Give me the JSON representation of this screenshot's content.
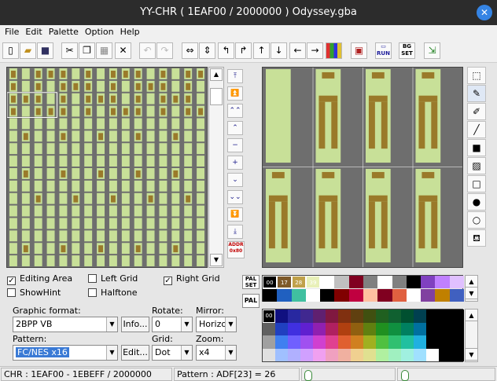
{
  "window": {
    "title": "YY-CHR ( 1EAF00 / 2000000 ) Odyssey.gba"
  },
  "menu": [
    "File",
    "Edit",
    "Palette",
    "Option",
    "Help"
  ],
  "toolbar": {
    "icons": [
      "new-file-icon",
      "open-folder-icon",
      "save-icon",
      "cut-icon",
      "copy-icon",
      "paste-icon",
      "delete-icon",
      "undo-icon",
      "redo-icon",
      "flip-horizontal-icon",
      "flip-vertical-icon",
      "rotate-left-icon",
      "rotate-right-icon",
      "shift-up-icon",
      "shift-down-icon",
      "shift-left-icon",
      "shift-right-icon",
      "palette-replace-icon",
      "script-icon",
      "run-icon",
      "set-icon",
      "exit-icon"
    ],
    "run_label": "RUN",
    "set_label": "SET"
  },
  "nav": {
    "addr_label": "ADDR",
    "addr_value": "0x80"
  },
  "tools": [
    "select-tool-icon",
    "pen-tool-icon",
    "line-tool-icon",
    "straight-line-icon",
    "filled-rect-icon",
    "pattern-fill-icon",
    "rect-tool-icon",
    "filled-circle-icon",
    "circle-tool-icon",
    "fill-bucket-icon"
  ],
  "options": {
    "editing_area": {
      "label": "Editing Area",
      "checked": true
    },
    "left_grid": {
      "label": "Left Grid",
      "checked": false
    },
    "right_grid": {
      "label": "Right Grid",
      "checked": true
    },
    "show_hint": {
      "label": "ShowHint",
      "checked": false
    },
    "halftone": {
      "label": "Halftone",
      "checked": false
    }
  },
  "graphic_format": {
    "label": "Graphic format:",
    "value": "2BPP VB",
    "button": "Info..."
  },
  "pattern": {
    "label": "Pattern:",
    "value": "FC/NES x16",
    "button": "Edit..."
  },
  "rotate": {
    "label": "Rotate:",
    "value": "0"
  },
  "mirror": {
    "label": "Mirror:",
    "value": "Horizo"
  },
  "grid": {
    "label": "Grid:",
    "value": "Dot"
  },
  "zoom": {
    "label": "Zoom:",
    "value": "x4"
  },
  "palette": {
    "pal_set_label": "PAL SET",
    "pal_label": "PAL",
    "selected_indices": [
      "00",
      "17",
      "28",
      "39"
    ],
    "row1_top": [
      "#000000",
      "#7e5a2a",
      "#c0a14a",
      "#e8f0b8",
      "#ffffff",
      "#c0c0c0",
      "#800020",
      "#808080",
      "#ffffff",
      "#808080",
      "#000000",
      "#8040c0",
      "#c080ff",
      "#e0c0ff"
    ],
    "row1_bottom": [
      "#000000",
      "#2060c0",
      "#40c0a0",
      "#ffffff",
      "#000000",
      "#800000",
      "#c00040",
      "#ffc0a0",
      "#800020",
      "#e06040",
      "#ffffff",
      "#8040a0",
      "#c08000",
      "#4060c0"
    ],
    "palette2_index": "00"
  },
  "status": {
    "chr": "CHR : 1EAF00 - 1EBEFF / 2000000",
    "pattern": "Pattern : ADF[23] = 26"
  }
}
